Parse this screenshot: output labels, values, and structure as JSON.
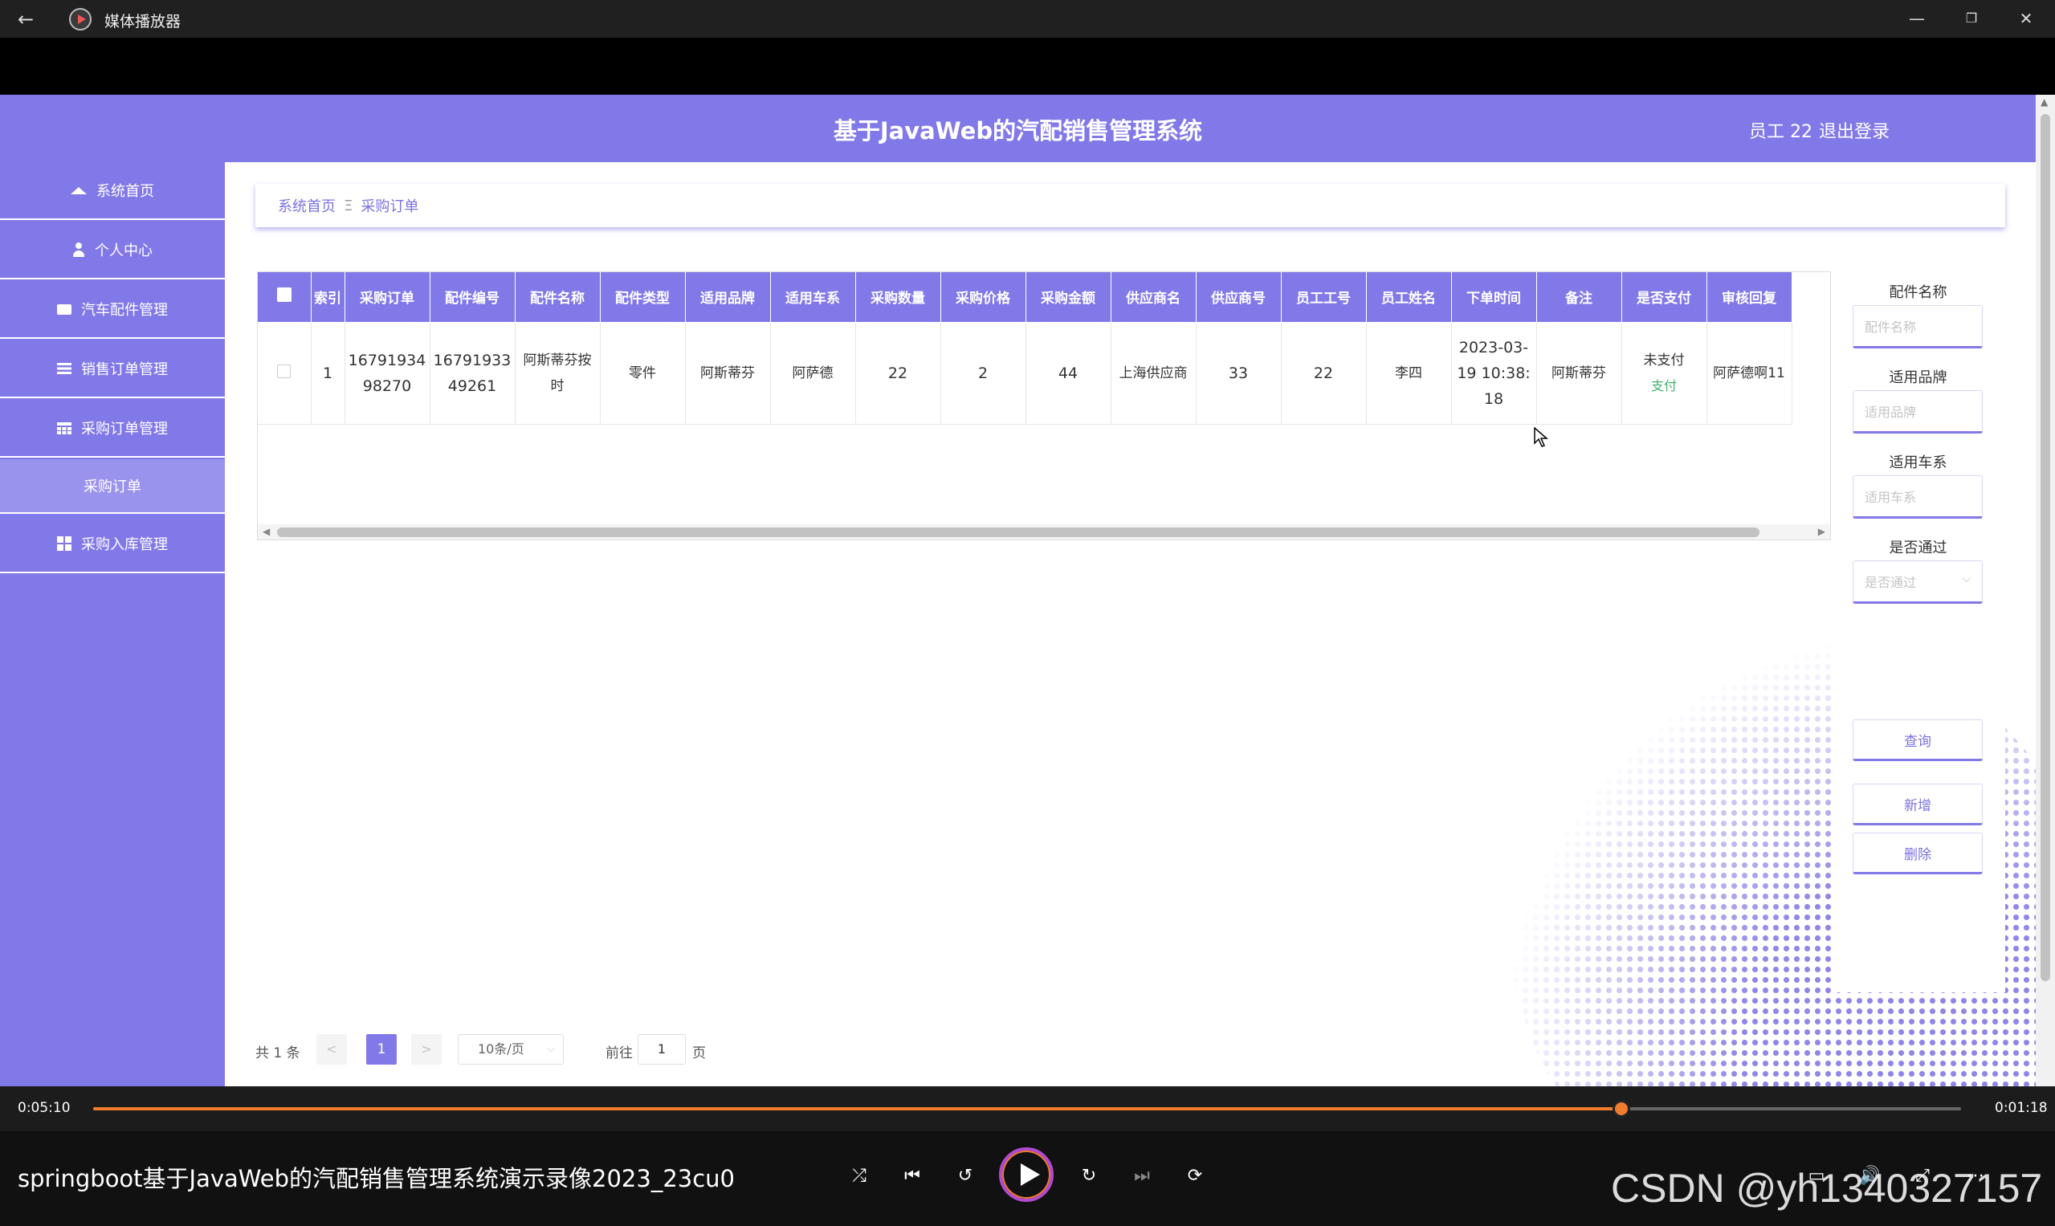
{
  "window": {
    "app_title": "媒体播放器",
    "back_icon": "back-arrow-icon",
    "minimize": "—",
    "maximize": "❐",
    "close": "✕"
  },
  "header": {
    "title": "基于JavaWeb的汽配销售管理系统",
    "user": "员工 22",
    "logout": "退出登录"
  },
  "sidebar": {
    "items": [
      {
        "label": "系统首页",
        "icon": "home-icon"
      },
      {
        "label": "个人中心",
        "icon": "user-icon"
      },
      {
        "label": "汽车配件管理",
        "icon": "monitor-icon"
      },
      {
        "label": "销售订单管理",
        "icon": "list-icon"
      },
      {
        "label": "采购订单管理",
        "icon": "table-icon"
      },
      {
        "label": "采购订单",
        "icon": ""
      },
      {
        "label": "采购入库管理",
        "icon": "grid-icon"
      }
    ]
  },
  "breadcrumb": {
    "home": "系统首页",
    "separator": "Ξ",
    "current": "采购订单"
  },
  "table": {
    "headers": [
      "",
      "索引",
      "采购订单",
      "配件编号",
      "配件名称",
      "配件类型",
      "适用品牌",
      "适用车系",
      "采购数量",
      "采购价格",
      "采购金额",
      "供应商名",
      "供应商号",
      "员工工号",
      "员工姓名",
      "下单时间",
      "备注",
      "是否支付",
      "审核回复"
    ],
    "rows": [
      {
        "index": "1",
        "order_no": "1679193498270",
        "part_no": "1679193349261",
        "part_name": "阿斯蒂芬按时",
        "part_type": "零件",
        "brand": "阿斯蒂芬",
        "series": "阿萨德",
        "qty": "22",
        "price": "2",
        "amount": "44",
        "supplier": "上海供应商",
        "supplier_no": "33",
        "emp_no": "22",
        "emp_name": "李四",
        "order_time": "2023-03-19 10:38:18",
        "remark": "阿斯蒂芬",
        "paid": "未支付",
        "pay_link": "支付",
        "review": "阿萨德啊11"
      }
    ]
  },
  "search": {
    "part_name_label": "配件名称",
    "part_name_placeholder": "配件名称",
    "brand_label": "适用品牌",
    "brand_placeholder": "适用品牌",
    "series_label": "适用车系",
    "series_placeholder": "适用车系",
    "approved_label": "是否通过",
    "approved_placeholder": "是否通过",
    "query_button": "查询",
    "add_button": "新增",
    "delete_button": "删除"
  },
  "pagination": {
    "total": "共 1 条",
    "prev": "<",
    "current_page": "1",
    "next": ">",
    "page_size": "10条/页",
    "goto_label": "前往",
    "goto_value": "1",
    "page_suffix": "页"
  },
  "player": {
    "elapsed": "0:05:10",
    "remaining": "0:01:18",
    "progress_fraction": 0.818,
    "video_title": "springboot基于JavaWeb的汽配销售管理系统演示录像2023_23cu0",
    "watermark": "CSDN @yh1340327157",
    "accent_color": "#f07c2c",
    "controls": [
      "shuffle-icon",
      "previous-icon",
      "rewind-10-icon",
      "play-icon",
      "forward-30-icon",
      "next-icon",
      "repeat-off-icon"
    ]
  },
  "colors": {
    "primary": "#8279e9",
    "pay_link": "#43b06c"
  }
}
